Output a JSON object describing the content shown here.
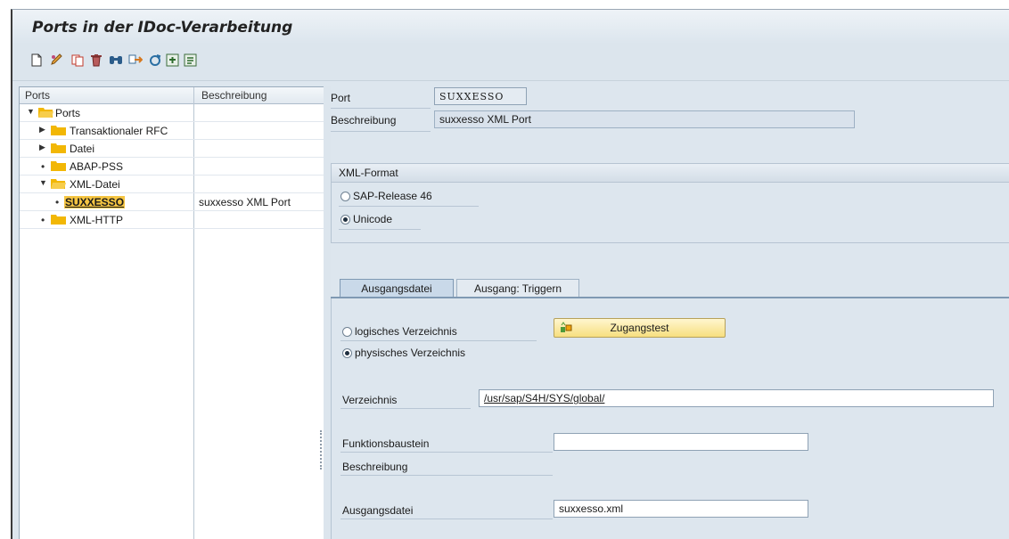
{
  "window": {
    "title": "Ports in der IDoc-Verarbeitung"
  },
  "toolbar": {
    "icons": [
      "new-document-icon",
      "edit-icon",
      "copy-icon",
      "delete-icon",
      "find-icon",
      "export-icon",
      "refresh-icon",
      "expand-icon",
      "collapse-icon"
    ]
  },
  "tree": {
    "col_ports": "Ports",
    "col_desc": "Beschreibung",
    "rows": [
      {
        "label": "Ports",
        "desc": ""
      },
      {
        "label": "Transaktionaler RFC",
        "desc": ""
      },
      {
        "label": "Datei",
        "desc": ""
      },
      {
        "label": "ABAP-PSS",
        "desc": ""
      },
      {
        "label": "XML-Datei",
        "desc": ""
      },
      {
        "label": "SUXXESSO",
        "desc": "suxxesso XML Port"
      },
      {
        "label": "XML-HTTP",
        "desc": ""
      }
    ]
  },
  "detail": {
    "port_label": "Port",
    "port_value": "SUXXESSO",
    "desc_label": "Beschreibung",
    "desc_value": "suxxesso XML Port"
  },
  "xml_format": {
    "title": "XML-Format",
    "option_release": "SAP-Release 46",
    "option_unicode": "Unicode",
    "selected": "Unicode"
  },
  "tabs": {
    "ausgangsdatei": "Ausgangsdatei",
    "ausgang_triggern": "Ausgang: Triggern"
  },
  "outfile": {
    "option_logical": "logisches Verzeichnis",
    "option_physical": "physisches Verzeichnis",
    "selected": "physisches Verzeichnis",
    "access_test_button": "Zugangstest",
    "dir_label": "Verzeichnis",
    "dir_value": "/usr/sap/S4H/SYS/global/",
    "func_label": "Funktionsbaustein",
    "func_value": "",
    "func_desc_label": "Beschreibung",
    "outfile_label": "Ausgangsdatei",
    "outfile_value": "suxxesso.xml"
  },
  "colors": {
    "selected_highlight": "#f5c542",
    "folder": "#f2b705",
    "active_tab": "#c9d9e9",
    "button": "#f7df7f"
  }
}
